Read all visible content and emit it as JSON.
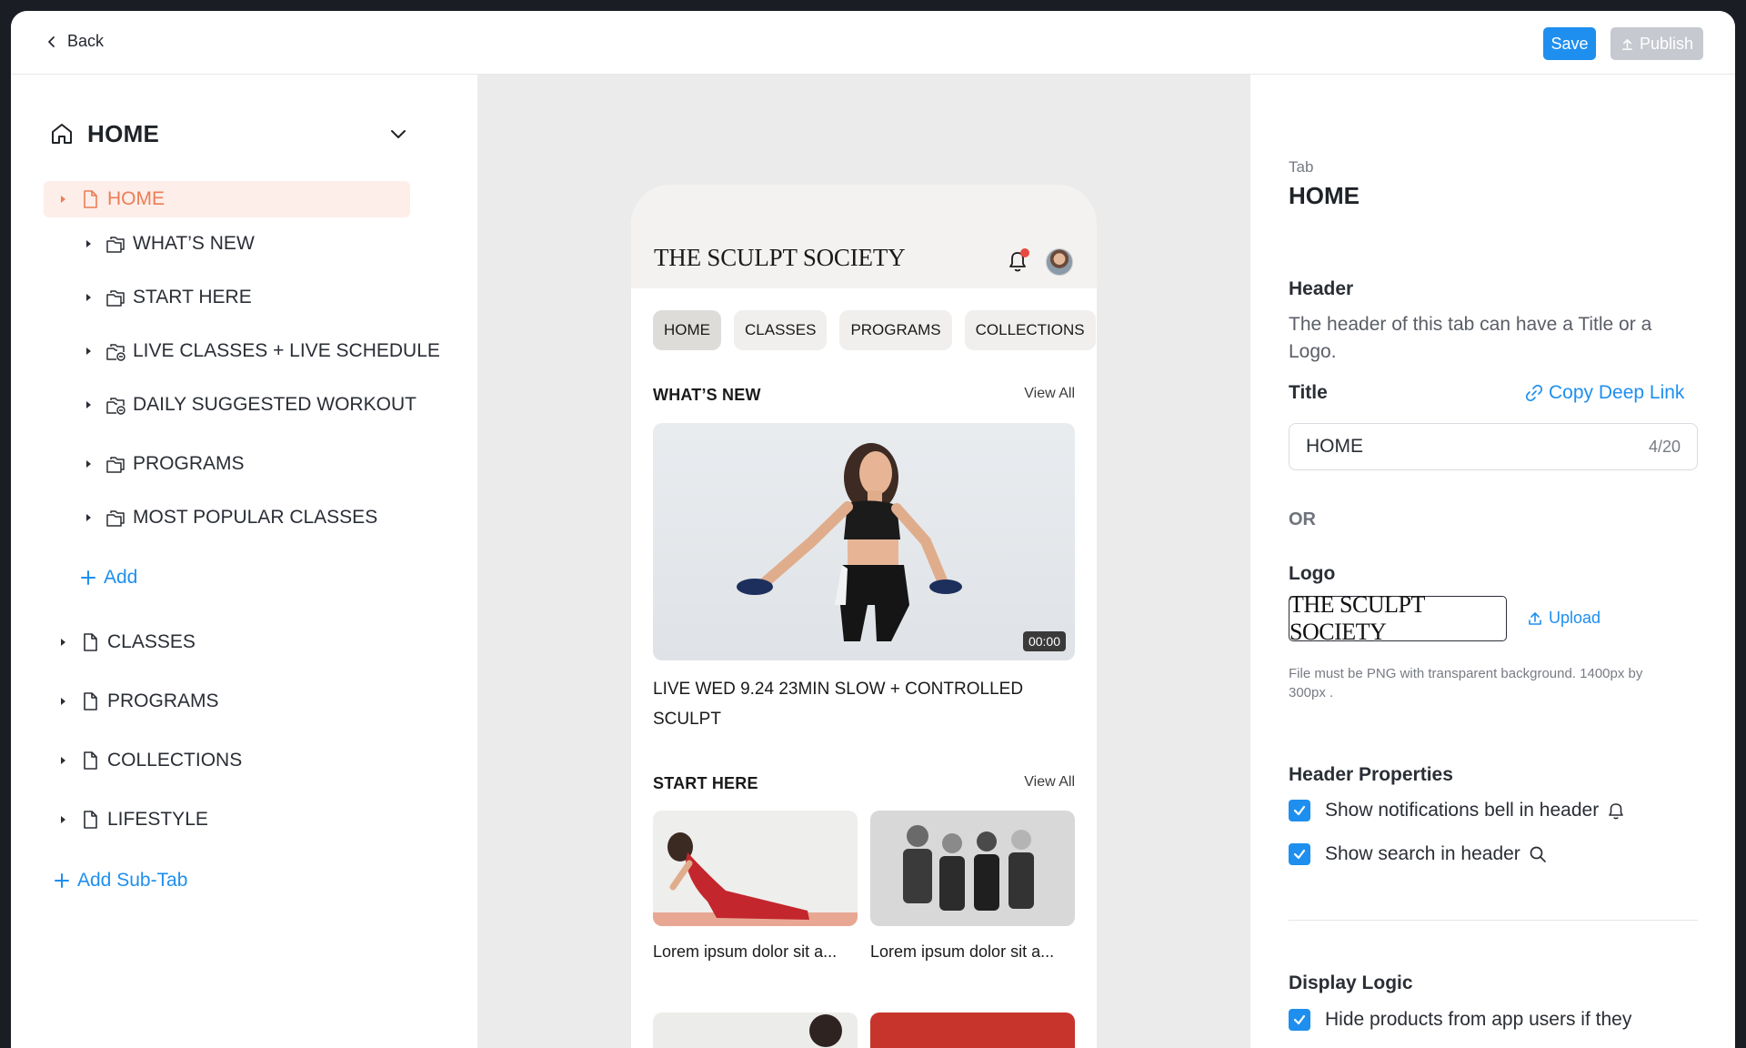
{
  "topbar": {
    "back_label": "Back",
    "save_label": "Save",
    "publish_label": "Publish"
  },
  "sidebar": {
    "tab_title": "HOME",
    "items": [
      {
        "label": "HOME",
        "icon": "page-icon",
        "active": true
      },
      {
        "label": "WHAT’S NEW",
        "icon": "folder-icon"
      },
      {
        "label": "START HERE",
        "icon": "folder-icon"
      },
      {
        "label": "LIVE CLASSES + LIVE SCHEDULE",
        "icon": "dynamic-folder-icon"
      },
      {
        "label": "DAILY SUGGESTED WORKOUT",
        "icon": "dynamic-folder-icon"
      },
      {
        "label": "PROGRAMS",
        "icon": "folder-icon"
      },
      {
        "label": "MOST POPULAR CLASSES",
        "icon": "folder-icon"
      }
    ],
    "add_label": "Add",
    "top_items": [
      {
        "label": "CLASSES",
        "icon": "page-icon"
      },
      {
        "label": "PROGRAMS",
        "icon": "page-icon"
      },
      {
        "label": "COLLECTIONS",
        "icon": "page-icon"
      },
      {
        "label": "LIFESTYLE",
        "icon": "page-icon"
      }
    ],
    "add_subtab_label": "Add Sub-Tab"
  },
  "preview": {
    "brand": "THE SCULPT SOCIETY",
    "tabs": [
      "HOME",
      "CLASSES",
      "PROGRAMS",
      "COLLECTIONS"
    ],
    "active_tab": "HOME",
    "sections": [
      {
        "title": "WHAT’S NEW",
        "view_all": "View All"
      },
      {
        "title": "START HERE",
        "view_all": "View All"
      }
    ],
    "hero": {
      "duration": "00:00",
      "caption": "LIVE WED 9.24 23MIN SLOW + CONTROLLED SCULPT"
    },
    "cards": [
      {
        "caption": "Lorem ipsum dolor sit a..."
      },
      {
        "caption": "Lorem ipsum dolor sit a..."
      }
    ]
  },
  "panel": {
    "kind_label": "Tab",
    "title": "HOME",
    "header_heading": "Header",
    "header_desc": "The header of this tab can have a Title or a Logo.",
    "title_label": "Title",
    "copy_link_label": "Copy Deep Link",
    "title_value": "HOME",
    "title_count": "4/20",
    "or_label": "OR",
    "logo_label": "Logo",
    "logo_text": "THE SCULPT SOCIETY",
    "upload_label": "Upload",
    "logo_hint": "File must be PNG with transparent background. 1400px by 300px .",
    "header_props_heading": "Header Properties",
    "show_bell_label": "Show notifications bell in header",
    "show_search_label": "Show search in header",
    "display_logic_heading": "Display Logic",
    "hide_products_label": "Hide products from app users if they"
  },
  "colors": {
    "accent": "#1e8fef",
    "active_item": "#ec7d56",
    "active_bg": "#fdeee9"
  }
}
